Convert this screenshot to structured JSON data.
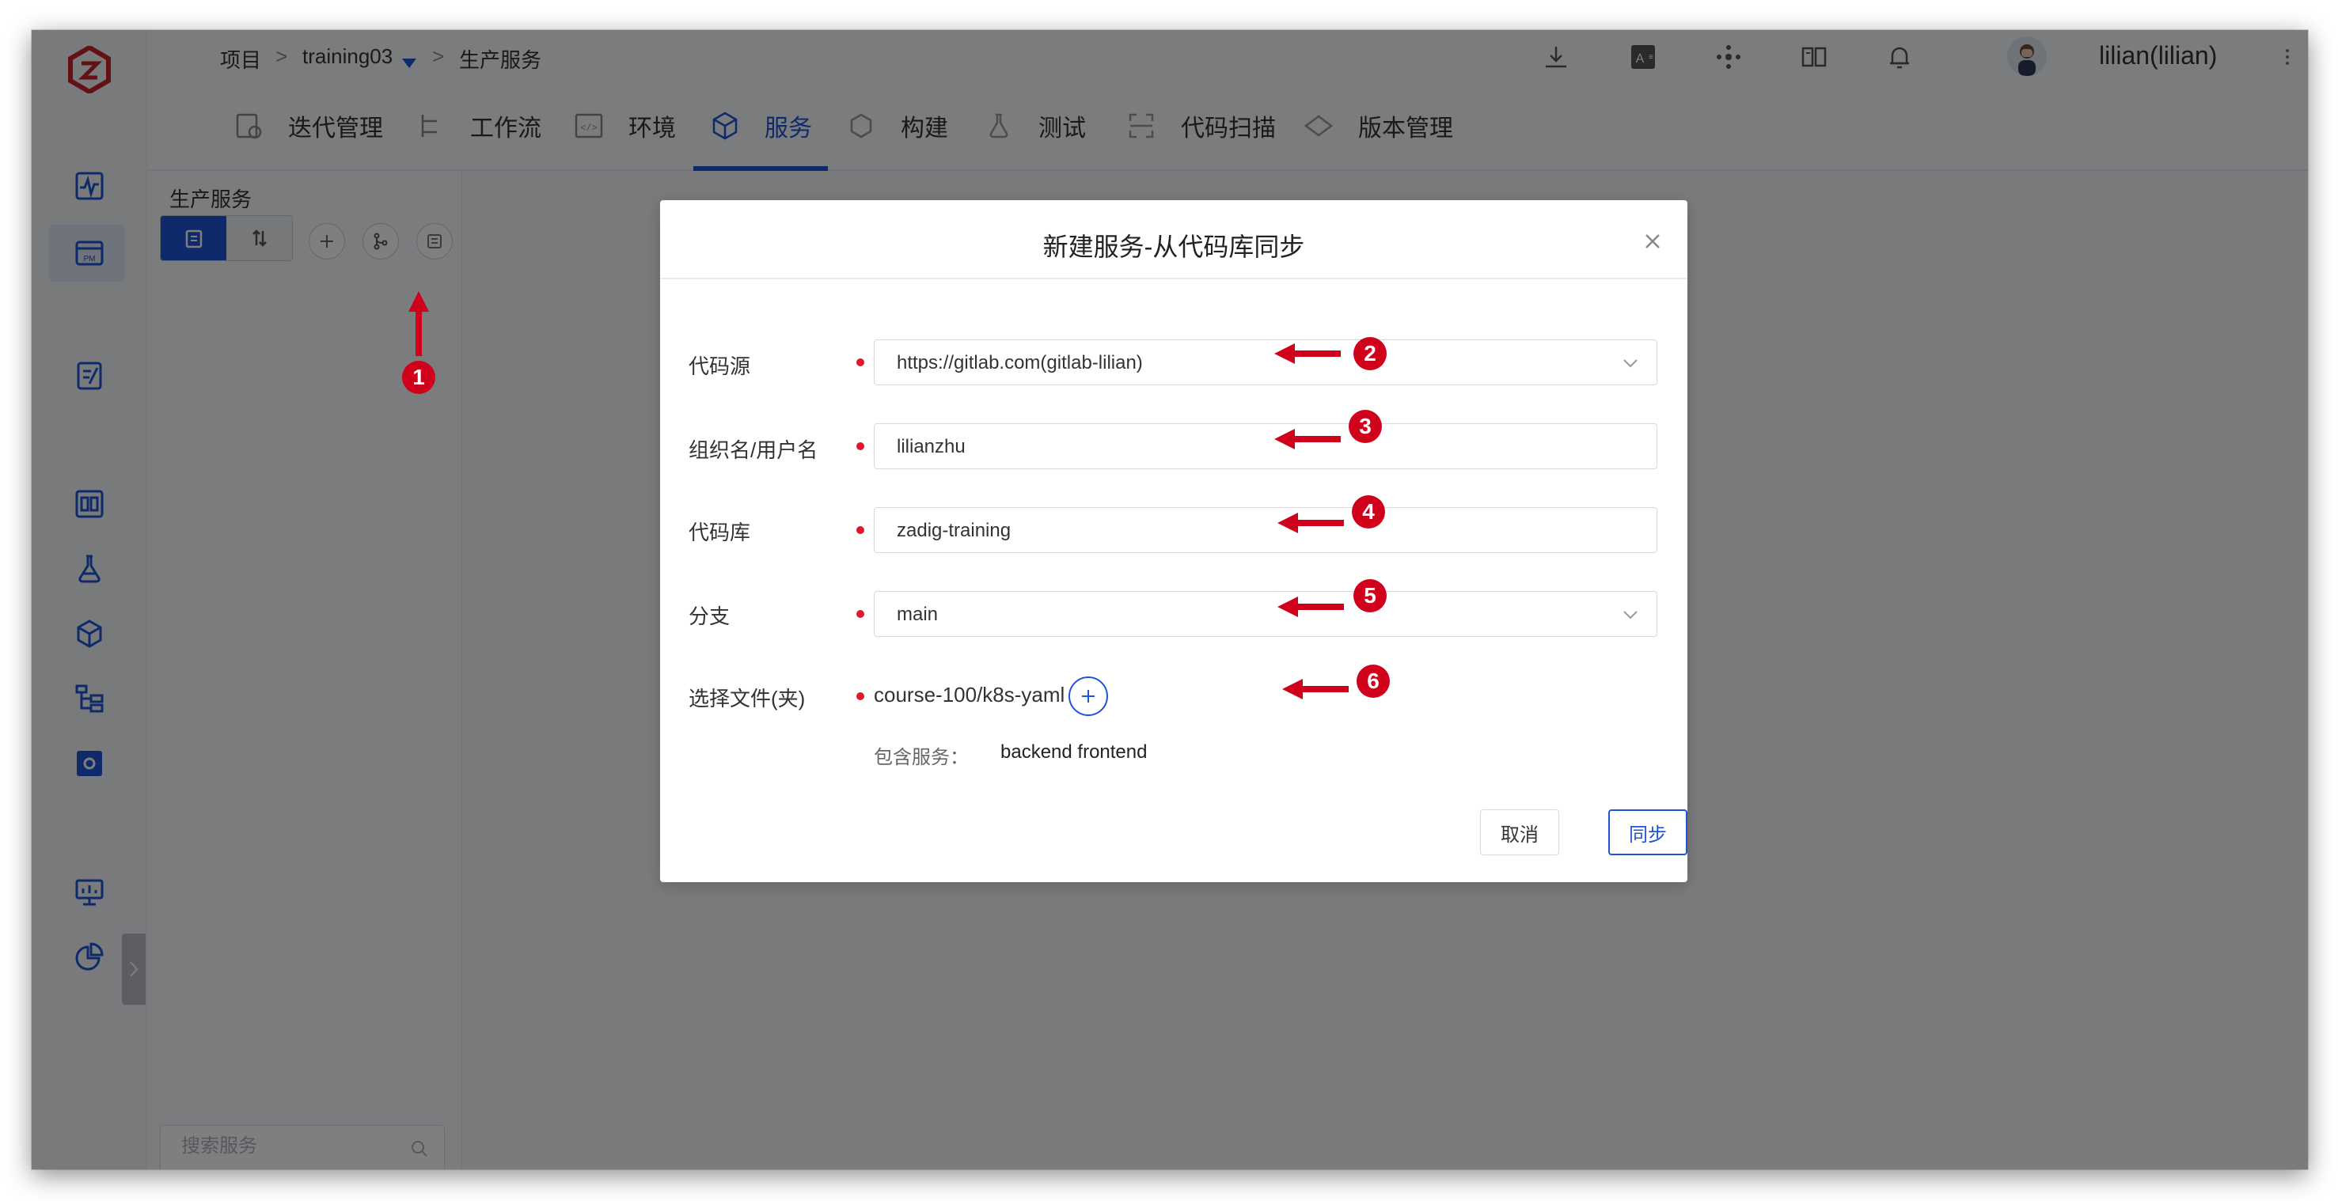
{
  "topbar": {
    "breadcrumb": [
      "项目",
      "training03",
      "生产服务"
    ],
    "breadcrumb_sep": ">",
    "user_name": "lilian(lilian)"
  },
  "nav": {
    "tabs": [
      {
        "label": "迭代管理",
        "icon": "iteration-icon"
      },
      {
        "label": "工作流",
        "icon": "workflow-icon"
      },
      {
        "label": "环境",
        "icon": "environment-icon"
      },
      {
        "label": "服务",
        "icon": "service-icon",
        "active": true
      },
      {
        "label": "构建",
        "icon": "build-icon"
      },
      {
        "label": "测试",
        "icon": "test-icon"
      },
      {
        "label": "代码扫描",
        "icon": "scan-icon"
      },
      {
        "label": "版本管理",
        "icon": "version-icon"
      }
    ]
  },
  "service_panel": {
    "title": "生产服务",
    "search_placeholder": "搜索服务"
  },
  "dialog": {
    "title": "新建服务-从代码库同步",
    "fields": {
      "code_source": {
        "label": "代码源",
        "value": "https://gitlab.com(gitlab-lilian)"
      },
      "org": {
        "label": "组织名/用户名",
        "value": "lilianzhu"
      },
      "repo": {
        "label": "代码库",
        "value": "zadig-training"
      },
      "branch": {
        "label": "分支",
        "value": "main"
      },
      "folder": {
        "label": "选择文件(夹)",
        "value": "course-100/k8s-yaml"
      }
    },
    "contains_label": "包含服务：",
    "contains_value": "backend frontend",
    "cancel_label": "取消",
    "sync_label": "同步"
  },
  "annotations": [
    "1",
    "2",
    "3",
    "4",
    "5",
    "6"
  ],
  "colors": {
    "accent": "#1d55d6",
    "annotation_red": "#d0021b",
    "required_dot": "#e0182b",
    "overlay": "rgba(0,0,0,0.5)"
  }
}
